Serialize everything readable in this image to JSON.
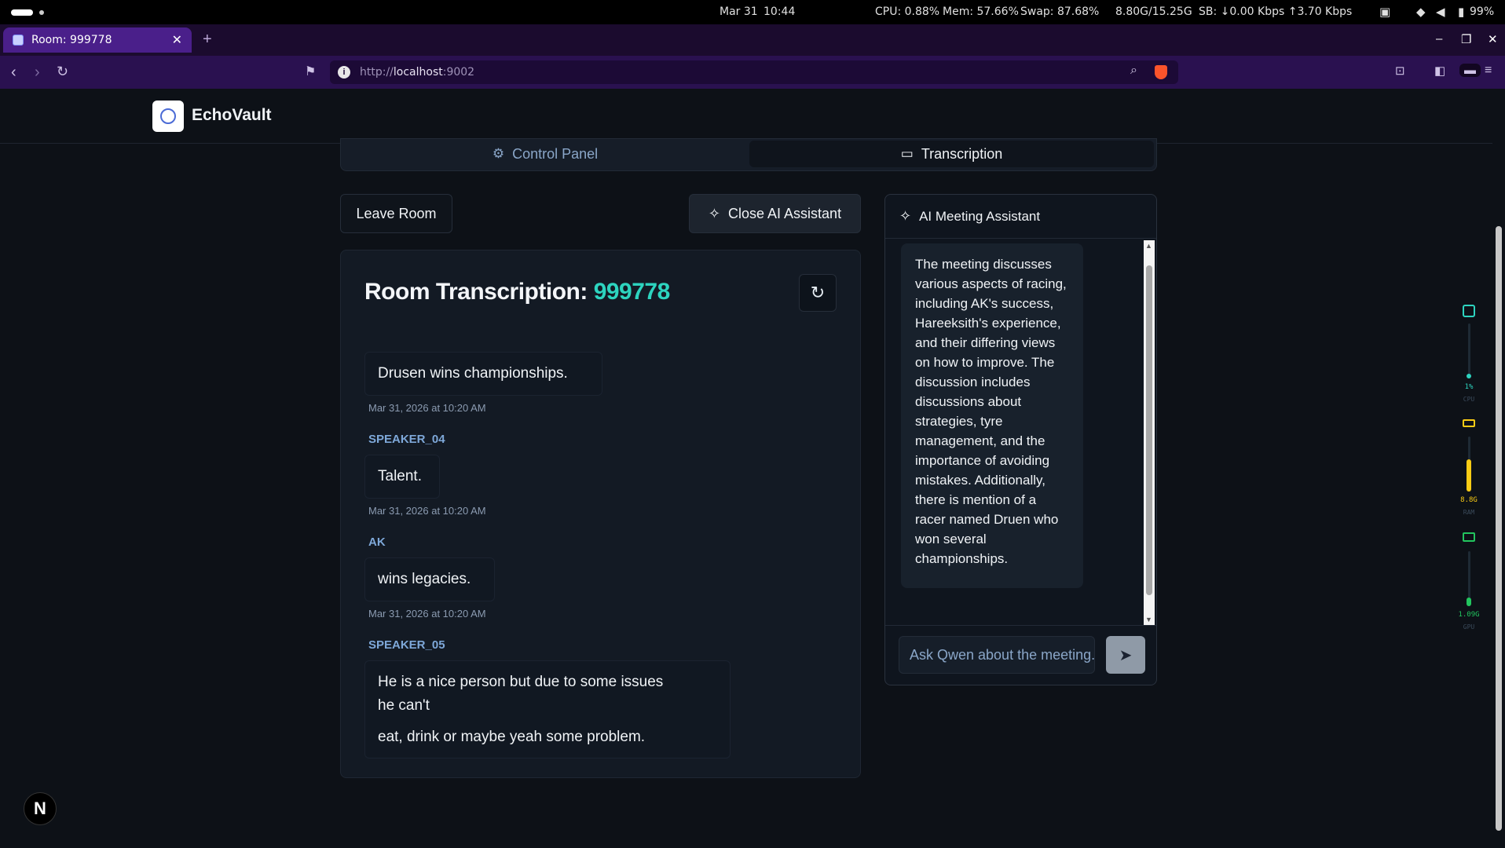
{
  "os": {
    "date": "Mar 31",
    "time": "10:44",
    "cpu": "CPU: 0.88%",
    "mem": "Mem: 57.66%",
    "swap": "Swap: 87.68%",
    "mem_used": "8.80G/15.25G",
    "net": "SB: ↓0.00 Kbps ↑3.70 Kbps",
    "battery": "99%"
  },
  "browser": {
    "tab_title": "Room: 999778",
    "url_scheme": "http://",
    "url_host": "localhost",
    "url_port": ":9002"
  },
  "app": {
    "brand": "EchoVault",
    "tabs": {
      "control_panel": "Control Panel",
      "transcription": "Transcription"
    },
    "leave_label": "Leave Room",
    "close_ai_label": "Close AI Assistant"
  },
  "transcription": {
    "title_prefix": "Room Transcription: ",
    "room_id": "999778",
    "messages": [
      {
        "text": "Drusen wins championships.",
        "time": "Mar 31, 2026 at 10:20 AM"
      },
      {
        "speaker": "SPEAKER_04",
        "text": "Talent.",
        "time": "Mar 31, 2026 at 10:20 AM"
      },
      {
        "speaker": "AK",
        "text": "wins legacies.",
        "time": "Mar 31, 2026 at 10:20 AM"
      },
      {
        "speaker": "SPEAKER_05",
        "line1": "He is a nice person but due to some issues",
        "line2": "he can't",
        "line3": "eat, drink or maybe yeah some problem."
      }
    ]
  },
  "assistant": {
    "title": "AI Meeting Assistant",
    "answer": "The meeting discusses various aspects of racing, including AK's success, Hareeksith's experience, and their differing views on how to improve. The discussion includes discussions about strategies, tyre management, and the importance of avoiding mistakes. Additionally, there is mention of a racer named Druen who won several championships.",
    "input_placeholder": "Ask Qwen about the meeting..."
  },
  "monitor": {
    "cpu_val": "1%",
    "cpu_lbl": "CPU",
    "cpu_level": 0.01,
    "ram_val": "8.8G",
    "ram_lbl": "RAM",
    "ram_level": 0.58,
    "gpu_val": "1.09G",
    "gpu_lbl": "GPU",
    "gpu_level": 0.15,
    "colors": {
      "cpu": "#2dd4bf",
      "ram": "#facc15",
      "gpu": "#22c55e"
    }
  }
}
